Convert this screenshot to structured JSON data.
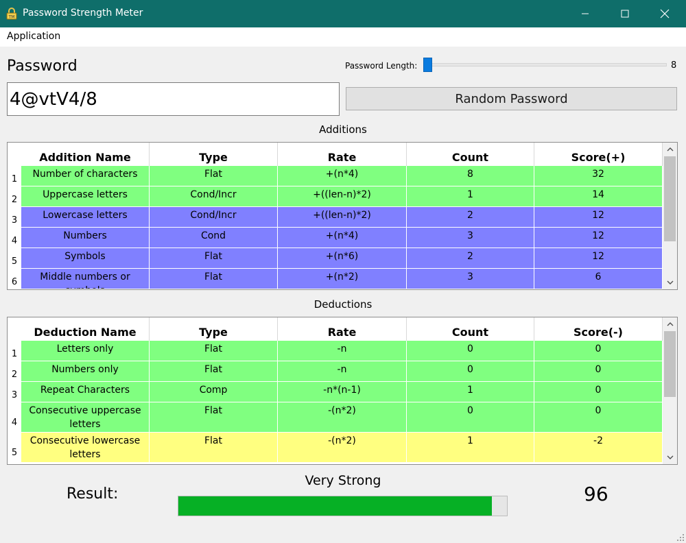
{
  "window": {
    "title": "Password Strength Meter",
    "accent": "#0f6e6a"
  },
  "menu": {
    "application": "Application"
  },
  "password": {
    "label": "Password",
    "value": "4@vtV4/8"
  },
  "length": {
    "label": "Password Length:",
    "value": "8",
    "fraction": 0.0
  },
  "random_button": "Random Password",
  "additions": {
    "title": "Additions",
    "columns": [
      "Addition Name",
      "Type",
      "Rate",
      "Count",
      "Score(+)"
    ],
    "rows": [
      {
        "num": "1",
        "name": "Number of characters",
        "type": "Flat",
        "rate": "+(n*4)",
        "count": "8",
        "score": "32",
        "color": "#80ff80"
      },
      {
        "num": "2",
        "name": "Uppercase letters",
        "type": "Cond/Incr",
        "rate": "+((len-n)*2)",
        "count": "1",
        "score": "14",
        "color": "#80ff80"
      },
      {
        "num": "3",
        "name": "Lowercase letters",
        "type": "Cond/Incr",
        "rate": "+((len-n)*2)",
        "count": "2",
        "score": "12",
        "color": "#8080ff"
      },
      {
        "num": "4",
        "name": "Numbers",
        "type": "Cond",
        "rate": "+(n*4)",
        "count": "3",
        "score": "12",
        "color": "#8080ff"
      },
      {
        "num": "5",
        "name": "Symbols",
        "type": "Flat",
        "rate": "+(n*6)",
        "count": "2",
        "score": "12",
        "color": "#8080ff"
      },
      {
        "num": "6",
        "name": "Middle numbers or symbols",
        "type": "Flat",
        "rate": "+(n*2)",
        "count": "3",
        "score": "6",
        "color": "#8080ff"
      }
    ]
  },
  "deductions": {
    "title": "Deductions",
    "columns": [
      "Deduction Name",
      "Type",
      "Rate",
      "Count",
      "Score(-)"
    ],
    "rows": [
      {
        "num": "1",
        "name": "Letters only",
        "type": "Flat",
        "rate": "-n",
        "count": "0",
        "score": "0",
        "color": "#80ff80"
      },
      {
        "num": "2",
        "name": "Numbers only",
        "type": "Flat",
        "rate": "-n",
        "count": "0",
        "score": "0",
        "color": "#80ff80"
      },
      {
        "num": "3",
        "name": "Repeat Characters",
        "type": "Comp",
        "rate": "-n*(n-1)",
        "count": "1",
        "score": "0",
        "color": "#80ff80"
      },
      {
        "num": "4",
        "name": "Consecutive uppercase letters",
        "type": "Flat",
        "rate": "-(n*2)",
        "count": "0",
        "score": "0",
        "color": "#80ff80"
      },
      {
        "num": "5",
        "name": "Consecutive lowercase letters",
        "type": "Flat",
        "rate": "-(n*2)",
        "count": "1",
        "score": "-2",
        "color": "#ffff80"
      }
    ]
  },
  "result": {
    "label": "Result:",
    "strength": "Very Strong",
    "score": "96",
    "progress": 0.955,
    "bar_color": "#06b025"
  }
}
